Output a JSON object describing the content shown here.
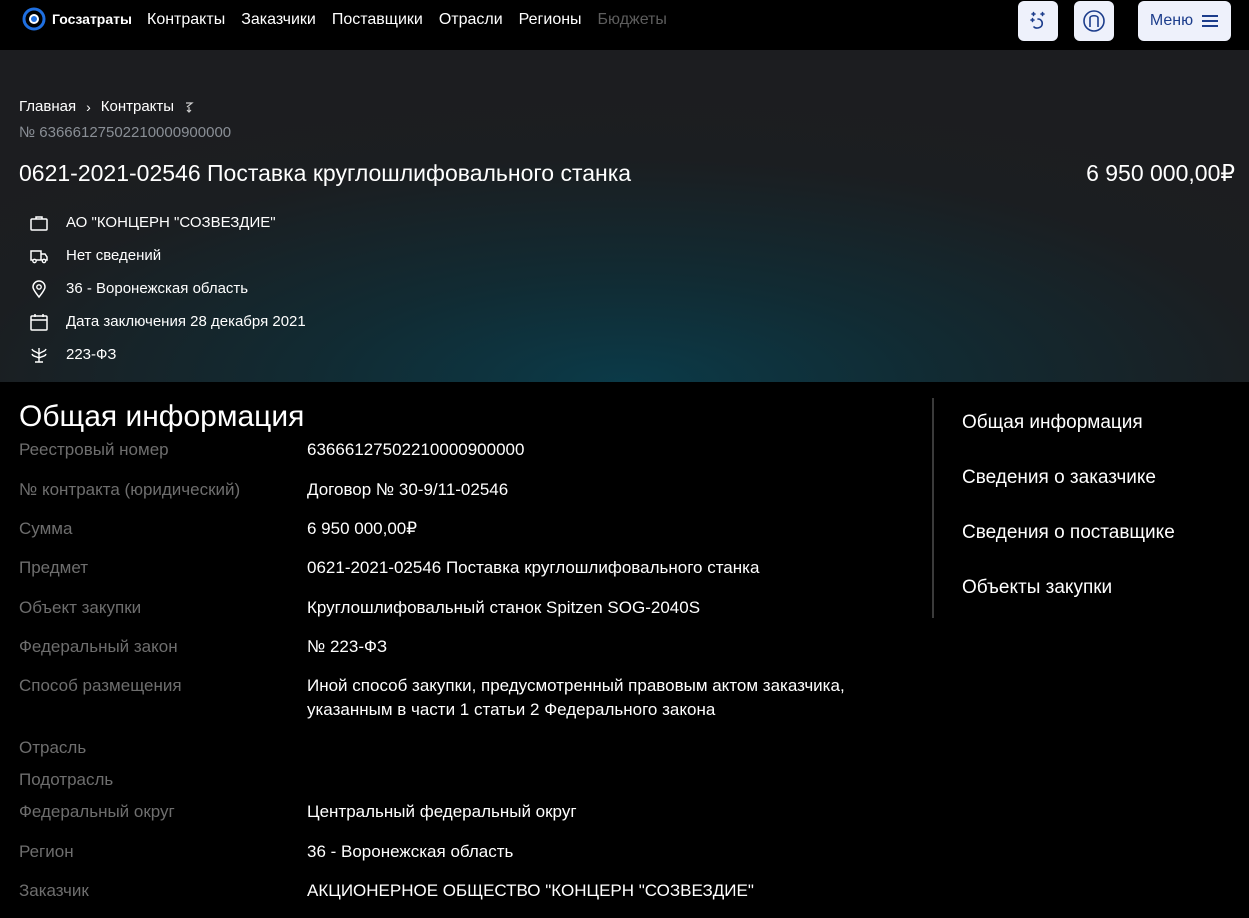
{
  "topbar": {
    "logo_text": "Госзатраты",
    "nav": [
      "Контракты",
      "Заказчики",
      "Поставщики",
      "Отрасли",
      "Регионы",
      "Бюджеты"
    ],
    "menu_label": "Меню"
  },
  "hero": {
    "breadcrumb": [
      "Главная",
      "Контракты"
    ],
    "regnum": "№ 63666127502210000900000",
    "title": "0621-2021-02546 Поставка круглошлифовального станка",
    "price": "6 950 000,00₽",
    "facts": [
      {
        "icon": "briefcase-icon",
        "text": "АО \"КОНЦЕРН \"СОЗВЕЗДИЕ\""
      },
      {
        "icon": "truck-icon",
        "text": "Нет сведений"
      },
      {
        "icon": "location-pin-icon",
        "text": "36 - Воронежская область"
      },
      {
        "icon": "calendar-icon",
        "text": "Дата заключения 28 декабря 2021"
      },
      {
        "icon": "law-emblem-icon",
        "text": "223-ФЗ"
      }
    ]
  },
  "general": {
    "heading": "Общая информация",
    "rows": [
      {
        "k": "Реестровый номер",
        "v": "63666127502210000900000"
      },
      {
        "k": "№ контракта (юридический)",
        "v": "Договор № 30-9/11-02546"
      },
      {
        "k": "Сумма",
        "v": "6 950 000,00₽"
      },
      {
        "k": "Предмет",
        "v": "0621-2021-02546 Поставка круглошлифовального станка"
      },
      {
        "k": "Объект закупки",
        "v": "Круглошлифовальный станок Spitzen SOG-2040S"
      },
      {
        "k": "Федеральный закон",
        "v": "№ 223-ФЗ"
      },
      {
        "k": "Способ размещения",
        "v": "Иной способ закупки, предусмотренный правовым актом заказчика, указанным в части 1 статьи 2 Федерального закона"
      },
      {
        "k": "Отрасль",
        "v": ""
      },
      {
        "k": "Подотрасль",
        "v": ""
      },
      {
        "k": "Федеральный округ",
        "v": "Центральный федеральный округ"
      },
      {
        "k": "Регион",
        "v": "36 - Воронежская область"
      },
      {
        "k": "Заказчик",
        "v": "АКЦИОНЕРНОЕ ОБЩЕСТВО \"КОНЦЕРН \"СОЗВЕЗДИЕ\""
      }
    ]
  },
  "toc": [
    "Общая информация",
    "Сведения о заказчике",
    "Сведения о поставщике",
    "Объекты закупки"
  ]
}
